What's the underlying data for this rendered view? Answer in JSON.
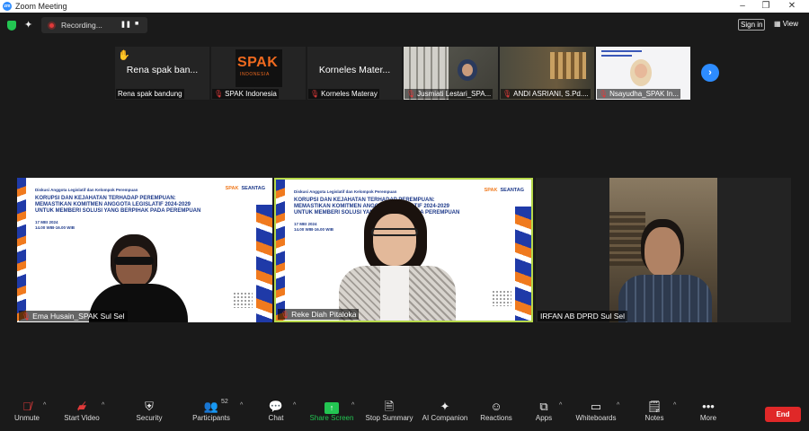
{
  "window": {
    "title": "Zoom Meeting",
    "logo_text": "zm"
  },
  "topbar": {
    "recording_label": "Recording...",
    "signin_label": "Sign in",
    "view_label": "View"
  },
  "thumbnails": [
    {
      "big": "Rena spak ban...",
      "label": "Rena spak bandung",
      "muted": false,
      "hand": true
    },
    {
      "big": "",
      "label": "SPAK Indonesia",
      "muted": true,
      "logo_main": "SPAK",
      "logo_sub": "INDONESIA"
    },
    {
      "big": "Korneles Mater...",
      "label": "Korneles Materay",
      "muted": true
    },
    {
      "big": "",
      "label": "Jusmiati Lestari_SPA...",
      "muted": true
    },
    {
      "big": "",
      "label": "ANDI ASRIANI, S.Pd....",
      "muted": true
    },
    {
      "big": "",
      "label": "Nsayudha_SPAK In...",
      "muted": true
    }
  ],
  "slide": {
    "small": "Diskusi Anggota Legislatif dan Kelompok Perempuan",
    "head1": "KORUPSI DAN KEJAHATAN TERHADAP PEREMPUAN:",
    "head2": "MEMASTIKAN KOMITMEN ANGGOTA LEGISLATIF 2024-2029",
    "head3": "UNTUK MEMBERI SOLUSI YANG BERPIHAK PADA PEREMPUAN",
    "date": "17 MEI 2024",
    "time": "14.00 WIB-16.00 WIB",
    "logo1": "SPAK",
    "logo2": "SEANTAG"
  },
  "tiles": [
    {
      "label": "Ema Husain_SPAK Sul Sel",
      "muted": true
    },
    {
      "label": "Reke Diah Pitaloka",
      "muted": true
    },
    {
      "label": "IRFAN AB DPRD Sul Sel",
      "muted": false
    }
  ],
  "toolbar": {
    "unmute": "Unmute",
    "start_video": "Start Video",
    "security": "Security",
    "participants": "Participants",
    "participants_count": "52",
    "chat": "Chat",
    "share_screen": "Share Screen",
    "stop_summary": "Stop Summary",
    "ai_companion": "AI Companion",
    "reactions": "Reactions",
    "apps": "Apps",
    "whiteboards": "Whiteboards",
    "notes": "Notes",
    "more": "More",
    "end": "End"
  }
}
